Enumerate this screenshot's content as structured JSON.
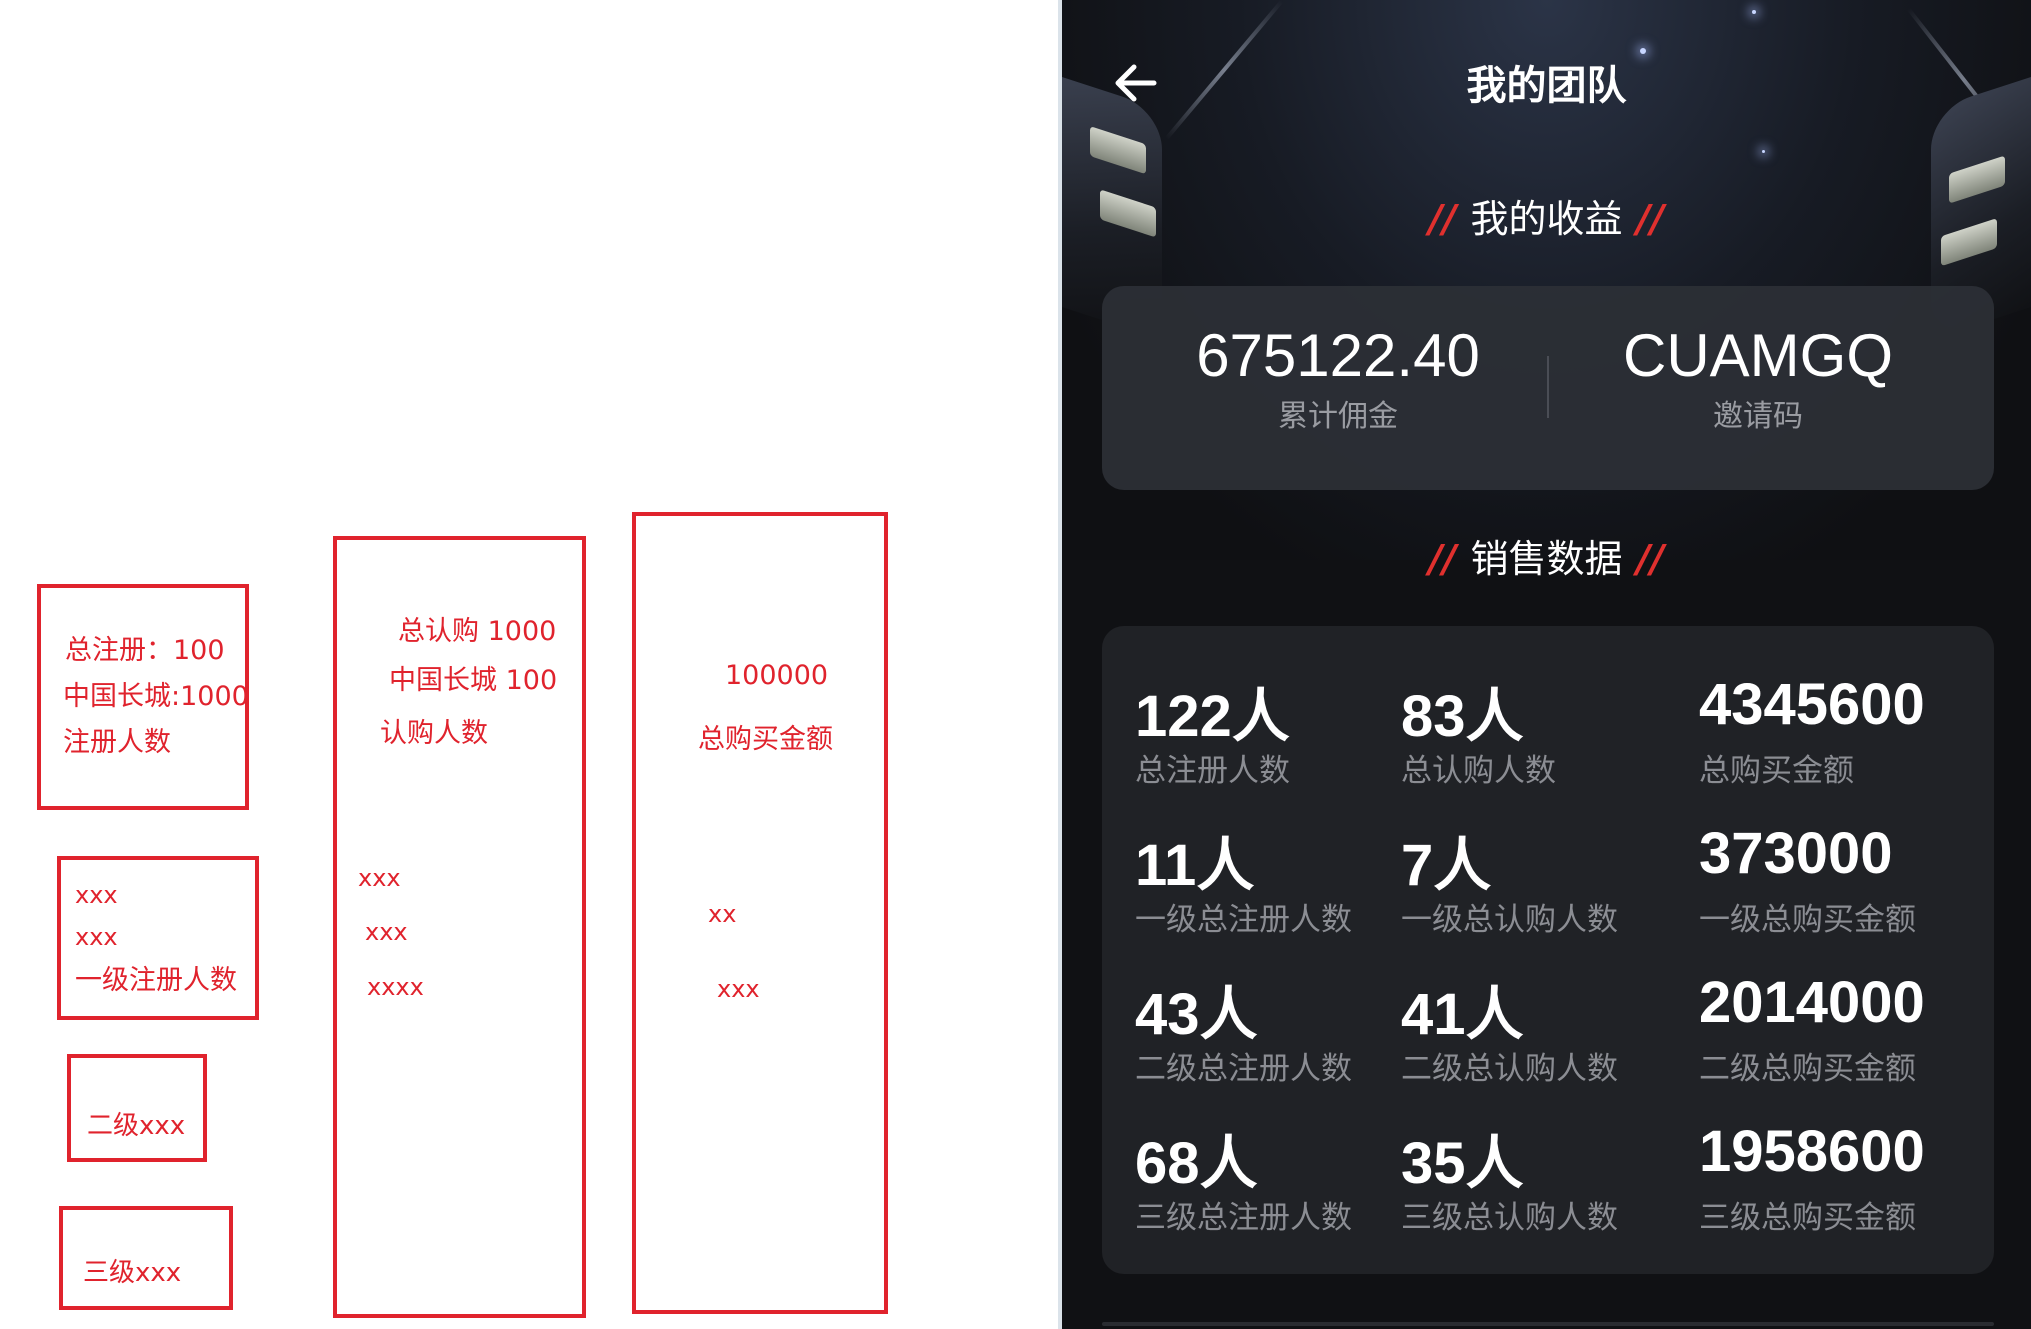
{
  "sketch": {
    "box1": {
      "line1": "总注册：100",
      "line2": "中国长城:1000",
      "line3": "注册人数"
    },
    "box2": {
      "line1": "xxx",
      "line2": "xxx",
      "line3": "一级注册人数"
    },
    "box3": {
      "line1": "二级xxx"
    },
    "box4": {
      "line1": "三级xxx"
    },
    "box5": {
      "line1": "总认购 1000",
      "line2": "中国长城 100",
      "line3": "认购人数",
      "line4": "xxx",
      "line5": "xxx",
      "line6": "xxxx"
    },
    "box6": {
      "line1": "100000",
      "line2": "总购买金额",
      "line3": "xx",
      "line4": "xxx"
    }
  },
  "header": {
    "title": "我的团队",
    "back_icon": "arrow-left-icon"
  },
  "earnings": {
    "section_title": "我的收益",
    "slash_left": "//",
    "slash_right": "//",
    "commission_value": "675122.40",
    "commission_label": "累计佣金",
    "invite_code_value": "CUAMGQ",
    "invite_code_label": "邀请码"
  },
  "sales": {
    "section_title": "销售数据",
    "slash_left": "//",
    "slash_right": "//",
    "rows": [
      [
        {
          "value": "122人",
          "label": "总注册人数"
        },
        {
          "value": "83人",
          "label": "总认购人数"
        },
        {
          "value": "4345600",
          "label": "总购买金额"
        }
      ],
      [
        {
          "value": "11人",
          "label": "一级总注册人数"
        },
        {
          "value": "7人",
          "label": "一级总认购人数"
        },
        {
          "value": "373000",
          "label": "一级总购买金额"
        }
      ],
      [
        {
          "value": "43人",
          "label": "二级总注册人数"
        },
        {
          "value": "41人",
          "label": "二级总认购人数"
        },
        {
          "value": "2014000",
          "label": "二级总购买金额"
        }
      ],
      [
        {
          "value": "68人",
          "label": "三级总注册人数"
        },
        {
          "value": "35人",
          "label": "三级总认购人数"
        },
        {
          "value": "1958600",
          "label": "三级总购买金额"
        }
      ]
    ]
  },
  "colors": {
    "accent_red": "#e0302e",
    "annotation_red": "#e0232d",
    "card_bg": "#202226",
    "screen_bg": "#101114"
  }
}
